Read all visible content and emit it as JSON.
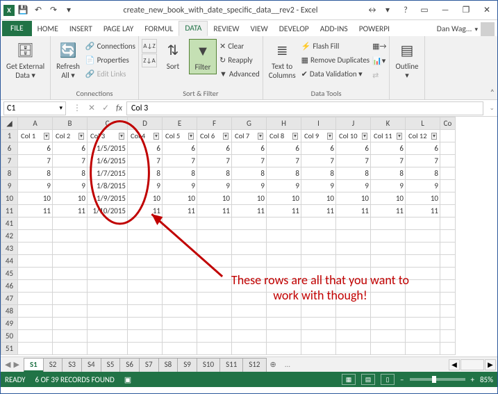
{
  "title": "create_new_book_with_date_specific_data__rev2 - Excel",
  "user": "Dan Wag...",
  "tabs": [
    "FILE",
    "HOME",
    "INSERT",
    "PAGE LAY",
    "FORMUL",
    "DATA",
    "REVIEW",
    "VIEW",
    "DEVELOP",
    "ADD-INS",
    "POWERPI"
  ],
  "active_tab": "DATA",
  "ribbon": {
    "get_external": "Get External\nData ▾",
    "refresh": "Refresh\nAll ▾",
    "connections_label": "Connections",
    "conn_items": [
      "Connections",
      "Properties",
      "Edit Links"
    ],
    "sort": "Sort",
    "filter": "Filter",
    "sort_filter_label": "Sort & Filter",
    "filter_items": [
      "Clear",
      "Reapply",
      "Advanced"
    ],
    "text_to_columns": "Text to\nColumns",
    "flash_fill": "Flash Fill",
    "remove_dup": "Remove Duplicates",
    "data_validation": "Data Validation  ▾",
    "consolidate": "",
    "whatif": "",
    "relationships": "",
    "data_tools_label": "Data Tools",
    "outline": "Outline\n▾"
  },
  "namebox": "C1",
  "formula": "Col 3",
  "columns_letters": [
    "A",
    "B",
    "C",
    "D",
    "E",
    "F",
    "G",
    "H",
    "I",
    "J",
    "K",
    "L"
  ],
  "header_row": [
    "Col 1",
    "Col 2",
    "Col 3",
    "Col 4",
    "Col 5",
    "Col 6",
    "Col 7",
    "Col 8",
    "Col 9",
    "Col 10",
    "Col 11",
    "Col 12"
  ],
  "rows": [
    {
      "n": 6,
      "vals": [
        6,
        6,
        "1/5/2015",
        6,
        6,
        6,
        6,
        6,
        6,
        6,
        6,
        6
      ]
    },
    {
      "n": 7,
      "vals": [
        7,
        7,
        "1/6/2015",
        7,
        7,
        7,
        7,
        7,
        7,
        7,
        7,
        7
      ]
    },
    {
      "n": 8,
      "vals": [
        8,
        8,
        "1/7/2015",
        8,
        8,
        8,
        8,
        8,
        8,
        8,
        8,
        8
      ]
    },
    {
      "n": 9,
      "vals": [
        9,
        9,
        "1/8/2015",
        9,
        9,
        9,
        9,
        9,
        9,
        9,
        9,
        9
      ]
    },
    {
      "n": 10,
      "vals": [
        10,
        10,
        "1/9/2015",
        10,
        10,
        10,
        10,
        10,
        10,
        10,
        10,
        10
      ]
    },
    {
      "n": 11,
      "vals": [
        11,
        11,
        "1/10/2015",
        11,
        11,
        11,
        11,
        11,
        11,
        11,
        11,
        11
      ]
    }
  ],
  "empty_rows": [
    41,
    42,
    43,
    44,
    45,
    46,
    47,
    48,
    49,
    50,
    51
  ],
  "annotation": "These rows are all that you\nwant to work with though!",
  "sheets": [
    "S1",
    "S2",
    "S3",
    "S4",
    "S5",
    "S6",
    "S7",
    "S8",
    "S9",
    "S10",
    "S11",
    "S12"
  ],
  "active_sheet": "S1",
  "status": {
    "ready": "READY",
    "records": "6 OF 39 RECORDS FOUND",
    "zoom": "85%"
  }
}
